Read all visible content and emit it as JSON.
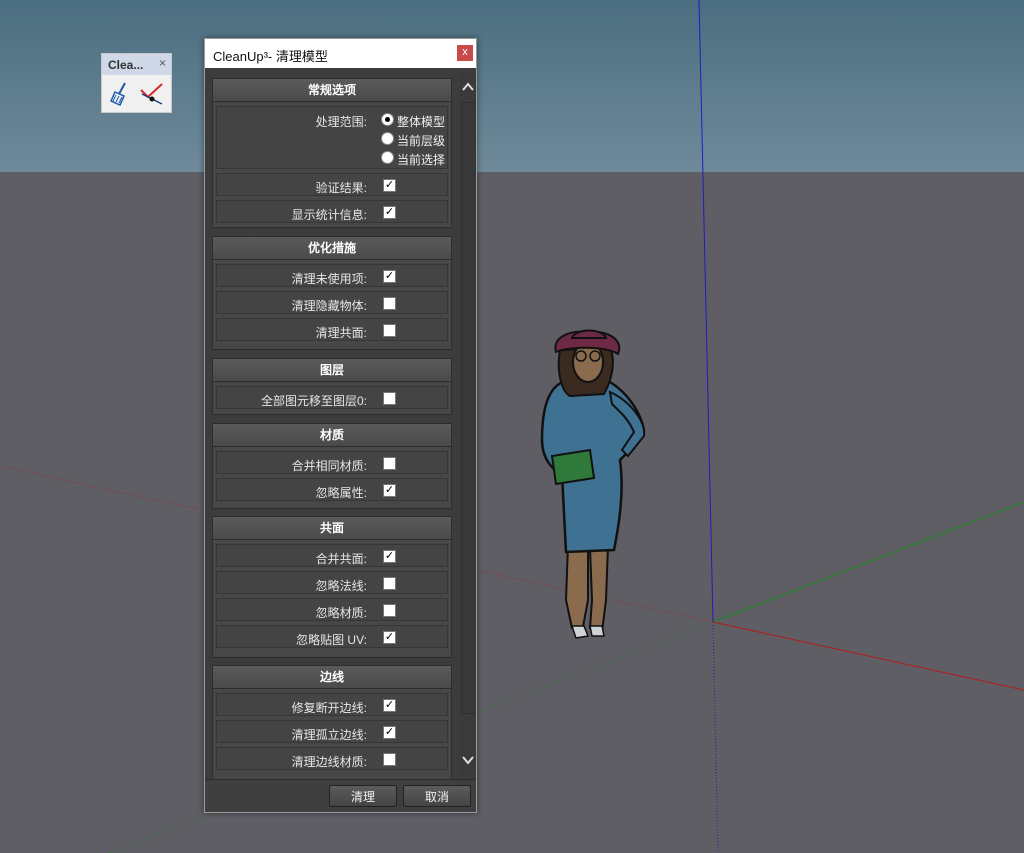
{
  "toolbar": {
    "title": "Clea...",
    "close": "×",
    "icons": [
      "broom-icon",
      "eraser-check-icon"
    ]
  },
  "dialog": {
    "title": "CleanUp³- 清理模型",
    "close": "x",
    "sections": {
      "general": {
        "title": "常规选项",
        "scope_label": "处理范围:",
        "scope_options": [
          "整体模型",
          "当前层级",
          "当前选择"
        ],
        "scope_selected": "整体模型",
        "validate_label": "验证结果:",
        "validate": true,
        "stats_label": "显示统计信息:",
        "stats": true
      },
      "optimize": {
        "title": "优化措施",
        "unused_label": "清理未使用项:",
        "unused": true,
        "hidden_label": "清理隐藏物体:",
        "hidden": false,
        "coplanar_label": "清理共面:",
        "coplanar": false
      },
      "layers": {
        "title": "图层",
        "move_label": "全部图元移至图层0:",
        "move": false
      },
      "materials": {
        "title": "材质",
        "merge_label": "合并相同材质:",
        "merge": false,
        "ignore_attr_label": "忽略属性:",
        "ignore_attr": true
      },
      "coplanar": {
        "title": "共面",
        "merge_label": "合并共面:",
        "merge": true,
        "ignore_normals_label": "忽略法线:",
        "ignore_normals": false,
        "ignore_mat_label": "忽略材质:",
        "ignore_mat": false,
        "ignore_uv_label": "忽略贴图 UV:",
        "ignore_uv": true
      },
      "edges": {
        "title": "边线",
        "repair_label": "修复断开边线:",
        "repair": true,
        "stray_label": "清理孤立边线:",
        "stray": true,
        "edge_mat_label": "清理边线材质:",
        "edge_mat": false
      }
    },
    "buttons": {
      "clean": "清理",
      "cancel": "取消"
    }
  },
  "colors": {
    "sky": "#5a7d8f",
    "ground": "#5f5e65",
    "blue_axis": "#1d1dc8",
    "green_axis": "#1a8a1a",
    "red_axis": "#b01c1c",
    "close_red": "#c94a4a"
  }
}
